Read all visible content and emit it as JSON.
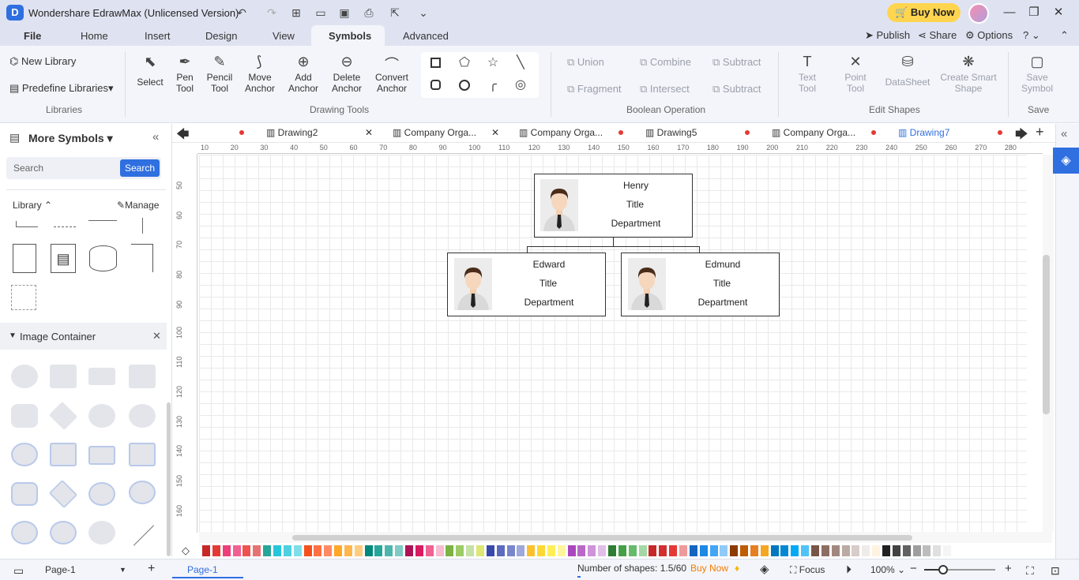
{
  "title_bar": {
    "app_icon": "D",
    "title": "Wondershare EdrawMax (Unlicensed Version)",
    "buy_now": "Buy Now"
  },
  "menu": {
    "items": [
      "File",
      "Home",
      "Insert",
      "Design",
      "View",
      "Symbols",
      "Advanced"
    ],
    "active": "Symbols",
    "right": {
      "publish": "Publish",
      "share": "Share",
      "options": "Options",
      "help": "?"
    }
  },
  "ribbon": {
    "libraries": {
      "new_library": "New Library",
      "predefine": "Predefine Libraries",
      "group": "Libraries"
    },
    "drawing_tools": {
      "items": [
        "Select",
        "Pen Tool",
        "Pencil Tool",
        "Move Anchor",
        "Add Anchor",
        "Delete Anchor",
        "Convert Anchor"
      ],
      "group": "Drawing Tools"
    },
    "boolean": {
      "union": "Union",
      "combine": "Combine",
      "subtract1": "Subtract",
      "fragment": "Fragment",
      "intersect": "Intersect",
      "subtract2": "Subtract",
      "group": "Boolean Operation"
    },
    "edit_shapes": {
      "text_tool": "Text Tool",
      "point_tool": "Point Tool",
      "datasheet": "DataSheet",
      "smart_shape": "Create Smart Shape",
      "group": "Edit Shapes"
    },
    "save": {
      "save_symbol": "Save Symbol",
      "group": "Save"
    }
  },
  "left_panel": {
    "title": "More Symbols",
    "search_placeholder": "Search",
    "search_button": "Search",
    "library_label": "Library",
    "manage": "Manage",
    "image_container": "Image Container"
  },
  "tabs": [
    "Drawing2",
    "Company Orga...",
    "Company Orga...",
    "Drawing5",
    "Company Orga...",
    "Drawing7"
  ],
  "active_tab": "Drawing7",
  "hruler": [
    "10",
    "20",
    "30",
    "40",
    "50",
    "60",
    "70",
    "80",
    "90",
    "100",
    "110",
    "120",
    "130",
    "140",
    "150",
    "160",
    "170",
    "180",
    "190",
    "200",
    "210",
    "220",
    "230",
    "240",
    "250",
    "260",
    "270",
    "280"
  ],
  "vruler": [
    "50",
    "60",
    "70",
    "80",
    "90",
    "100",
    "110",
    "120",
    "130",
    "140",
    "150",
    "160"
  ],
  "org": {
    "top": {
      "name": "Henry",
      "title": "Title",
      "dept": "Department"
    },
    "left": {
      "name": "Edward",
      "title": "Title",
      "dept": "Department"
    },
    "right": {
      "name": "Edmund",
      "title": "Title",
      "dept": "Department"
    }
  },
  "palette": [
    "#c62828",
    "#e53935",
    "#ec407a",
    "#f06292",
    "#ef5350",
    "#e57373",
    "#26a69a",
    "#26c6da",
    "#4dd0e1",
    "#80deea",
    "#f4511e",
    "#ff7043",
    "#ff8a65",
    "#ffa726",
    "#ffb74d",
    "#ffcc80",
    "#00897b",
    "#26a69a",
    "#4db6ac",
    "#80cbc4",
    "#ad1457",
    "#d81b60",
    "#f06292",
    "#f8bbd0",
    "#7cb342",
    "#9ccc65",
    "#c5e1a5",
    "#dce775",
    "#3949ab",
    "#5c6bc0",
    "#7986cb",
    "#9fa8da",
    "#fbc02d",
    "#fdd835",
    "#ffee58",
    "#fff59d",
    "#ab47bc",
    "#ba68c8",
    "#ce93d8",
    "#e1bee7",
    "#2e7d32",
    "#43a047",
    "#66bb6a",
    "#a5d6a7",
    "#c62828",
    "#d32f2f",
    "#e53935",
    "#ef9a9a",
    "#1565c0",
    "#1e88e5",
    "#42a5f5",
    "#90caf9",
    "#8d3a00",
    "#bf5b00",
    "#e67e22",
    "#f5a623",
    "#0277bd",
    "#0288d1",
    "#03a9f4",
    "#4fc3f7",
    "#795548",
    "#8d6e63",
    "#a1887f",
    "#bcaaa4",
    "#d7ccc8",
    "#efebe9",
    "#fff3e0",
    "#212121",
    "#424242",
    "#616161",
    "#9e9e9e",
    "#bdbdbd",
    "#e0e0e0",
    "#f5f5f5"
  ],
  "status": {
    "page_select": "Page-1",
    "page_tab": "Page-1",
    "shapes": "Number of shapes: 1.5/60",
    "buy_now": "Buy Now",
    "focus": "Focus",
    "zoom": "100%"
  }
}
